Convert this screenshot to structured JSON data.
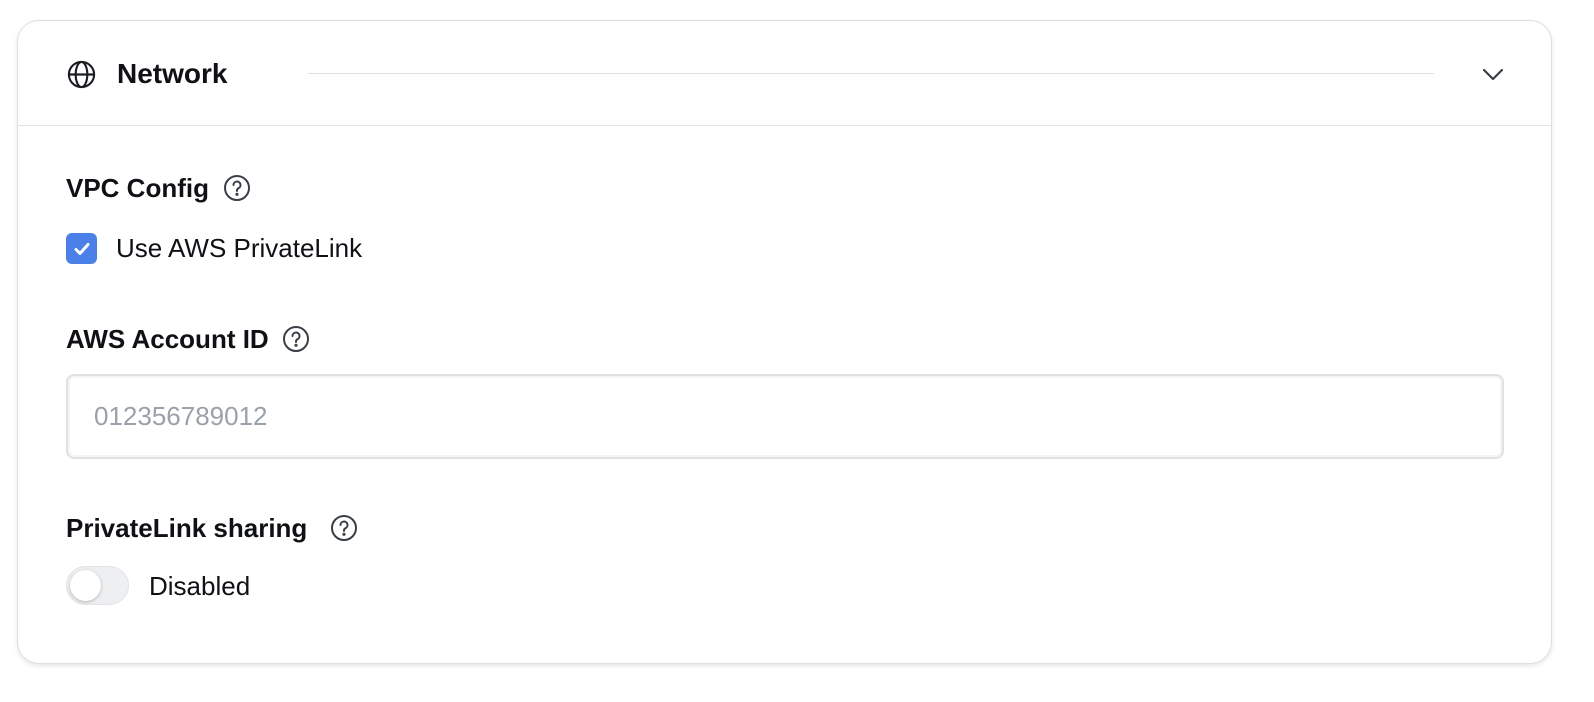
{
  "section": {
    "title": "Network",
    "icon": "globe-icon",
    "collapse_icon": "chevron-down-icon"
  },
  "vpc_config": {
    "label": "VPC Config",
    "help_icon": "help-circle-icon",
    "checkbox": {
      "label": "Use AWS PrivateLink",
      "checked": true
    }
  },
  "aws_account": {
    "label": "AWS Account ID",
    "help_icon": "help-circle-icon",
    "input": {
      "value": "",
      "placeholder": "012356789012"
    }
  },
  "privatelink_sharing": {
    "label": "PrivateLink sharing",
    "help_icon": "help-circle-icon",
    "toggle": {
      "state_label": "Disabled",
      "enabled": false
    }
  },
  "colors": {
    "accent": "#4a80e8",
    "border": "#dcdfe3",
    "placeholder": "#9aa1ab",
    "toggle_off": "#eeeff1"
  }
}
